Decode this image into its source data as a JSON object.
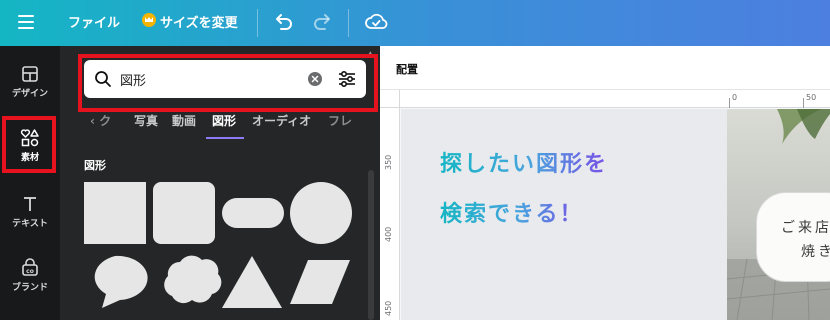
{
  "topbar": {
    "menu_icon": "hamburger-icon",
    "file_label": "ファイル",
    "resize_label": "サイズを変更",
    "undo_icon": "undo-icon",
    "redo_icon": "redo-icon",
    "cloud_icon": "cloud-check-icon"
  },
  "leftnav": {
    "items": [
      {
        "label": "デザイン",
        "icon": "layout-icon"
      },
      {
        "label": "素材",
        "icon": "elements-icon"
      },
      {
        "label": "テキスト",
        "icon": "text-icon"
      },
      {
        "label": "ブランド",
        "icon": "brand-icon"
      }
    ],
    "active_index": 1
  },
  "panel": {
    "search": {
      "value": "図形",
      "placeholder": "図形"
    },
    "tabs": [
      "‹ ク",
      "写真",
      "動画",
      "図形",
      "オーディオ",
      "フレ"
    ],
    "active_tab": "図形",
    "section_title": "図形"
  },
  "canvas": {
    "toolbar_label": "配置",
    "ruler_top": [
      "0",
      "50"
    ],
    "ruler_left": [
      "350",
      "400",
      "450"
    ],
    "overlay_line1": "探したい図形を",
    "overlay_line2": "検索できる！",
    "card_line1": "ご来店",
    "card_line2": "焼き"
  },
  "colors": {
    "topbar_start": "#14b6c4",
    "topbar_end": "#4d7fe0",
    "highlight_red": "#e6131e",
    "panel_bg": "#252627",
    "nav_bg": "#18191b",
    "tab_accent": "#8b7bf5"
  }
}
